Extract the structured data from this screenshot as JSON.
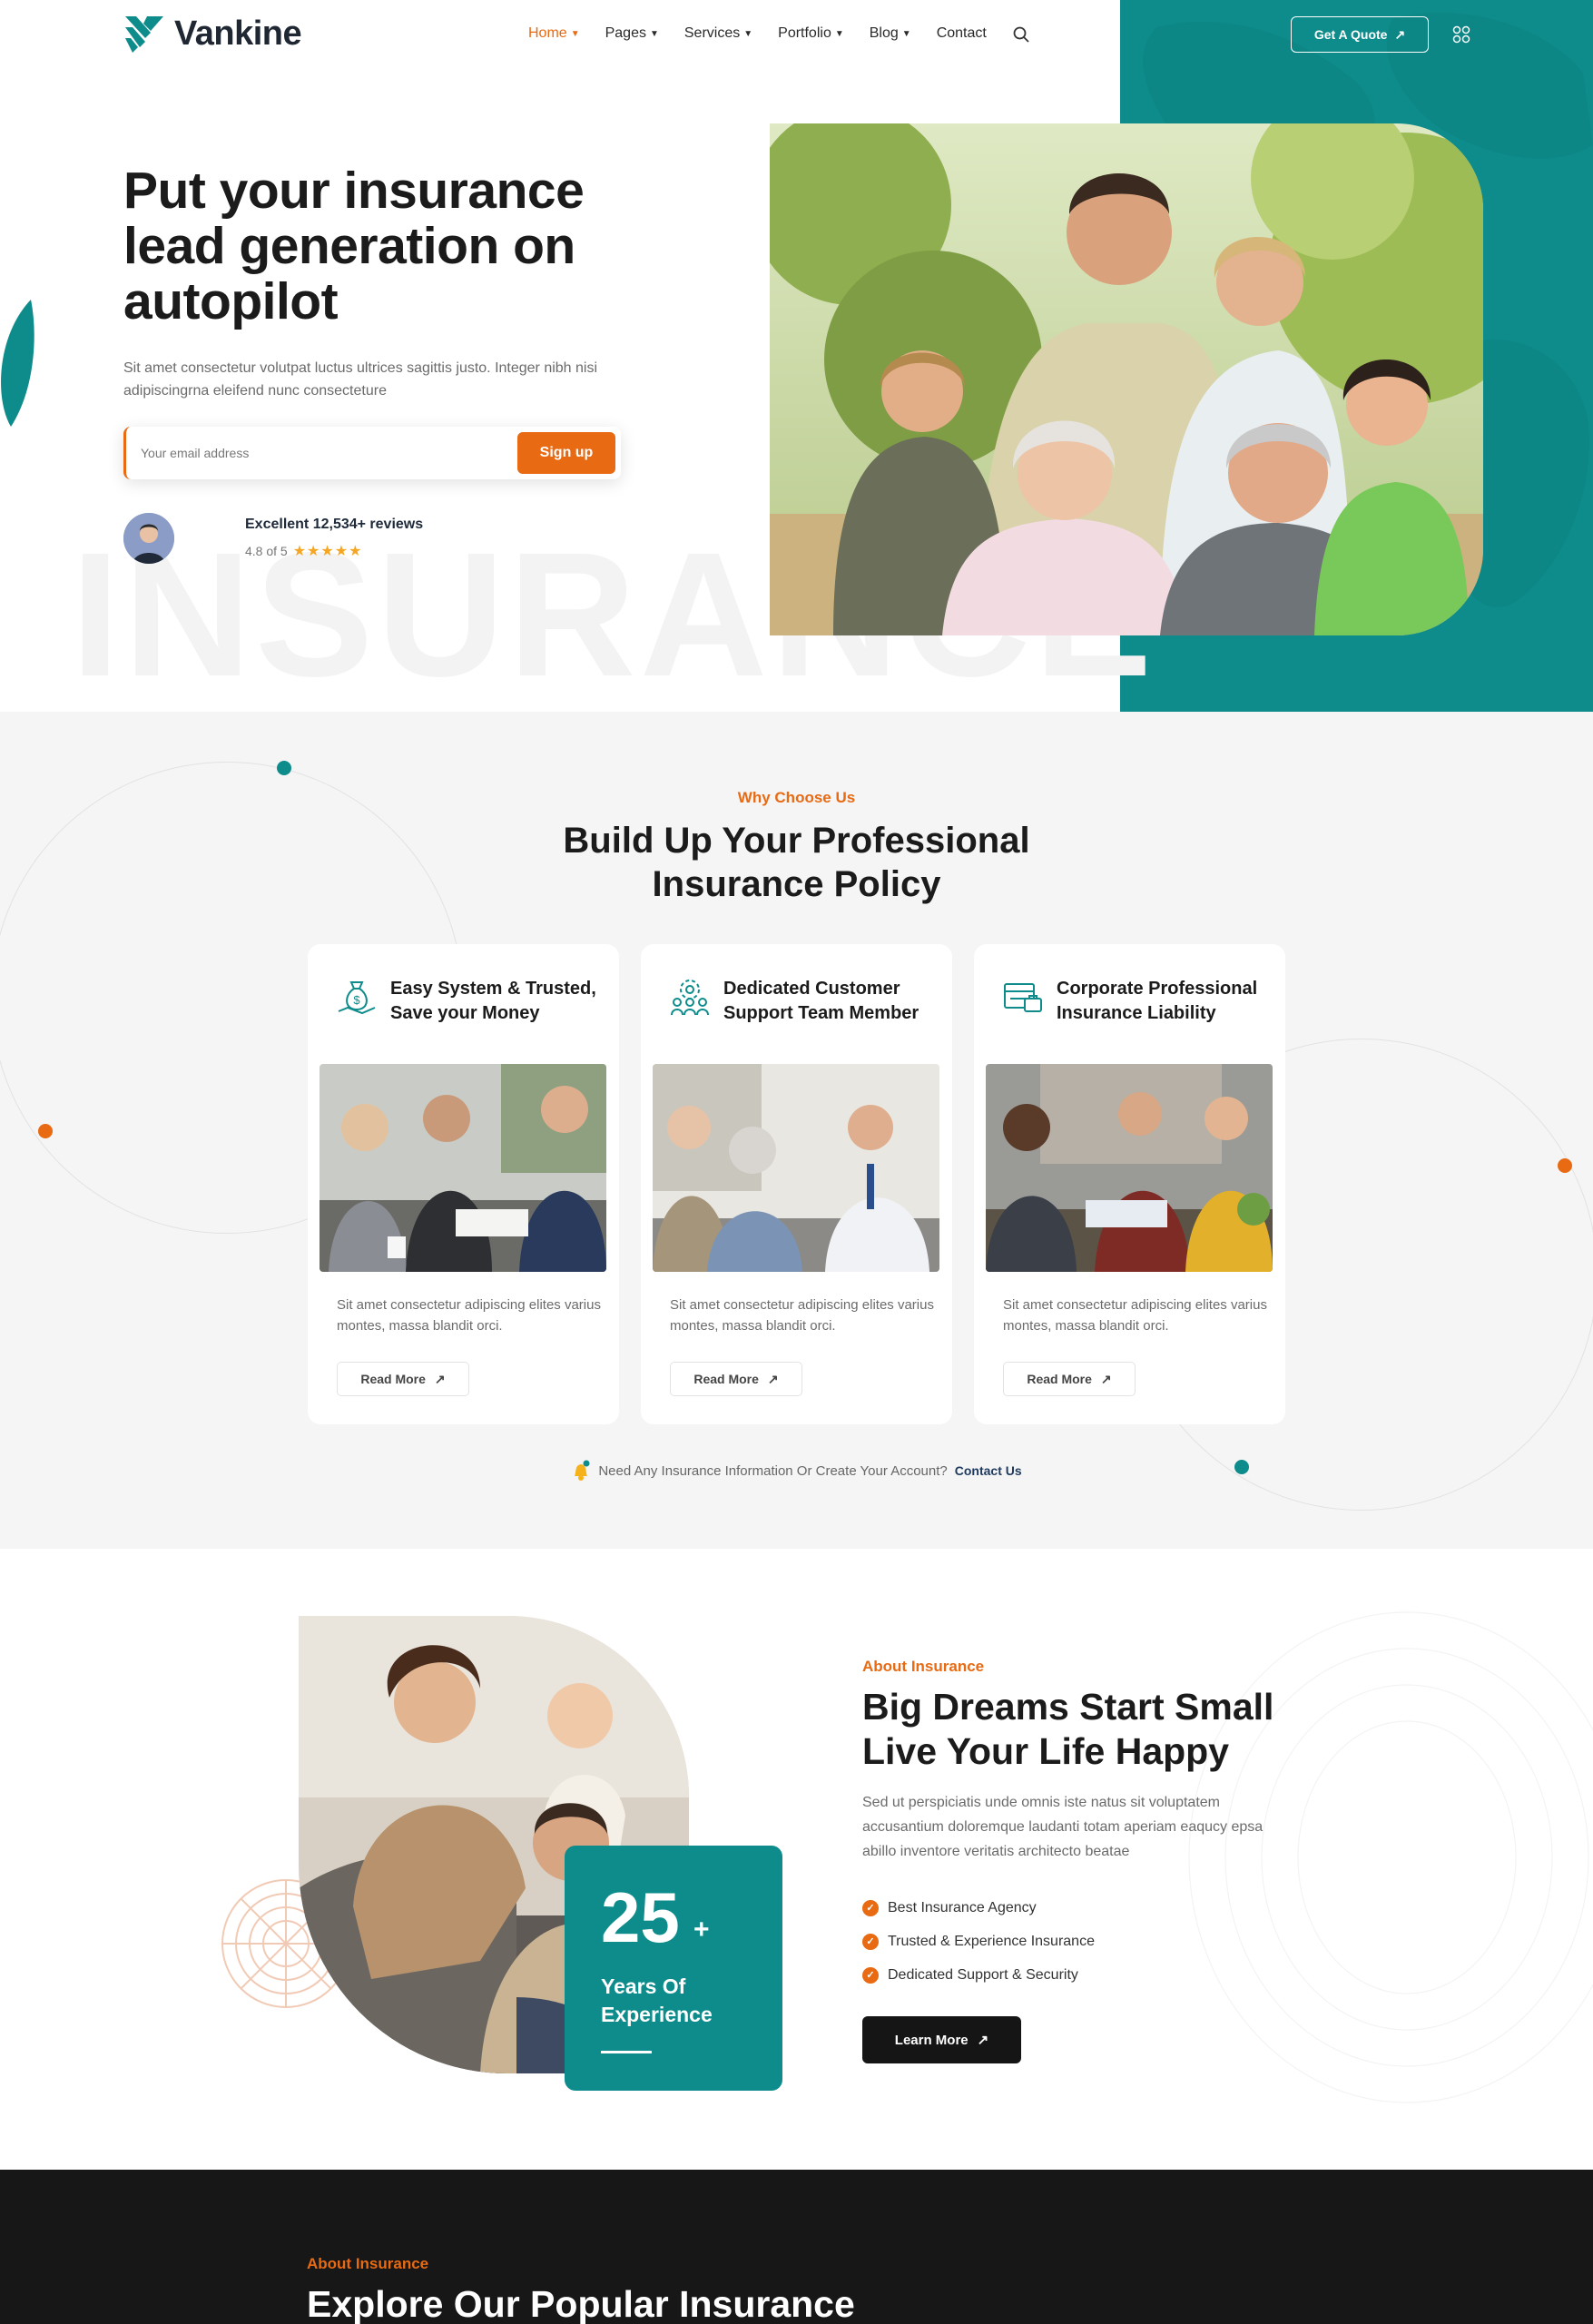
{
  "brand": {
    "name": "Vankine",
    "teal": "#0e8c8c",
    "orange": "#e86a12",
    "dark": "#171717"
  },
  "nav": {
    "items": [
      {
        "label": "Home",
        "active": true,
        "dropdown": true
      },
      {
        "label": "Pages",
        "dropdown": true
      },
      {
        "label": "Services",
        "dropdown": true
      },
      {
        "label": "Portfolio",
        "dropdown": true
      },
      {
        "label": "Blog",
        "dropdown": true
      },
      {
        "label": "Contact",
        "dropdown": false
      }
    ],
    "quote_label": "Get A Quote"
  },
  "hero": {
    "title": "Put your insurance lead generation on autopilot",
    "desc": "Sit amet consectetur volutpat luctus ultrices sagittis justo. Integer nibh nisi adipiscingrna eleifend nunc consecteture",
    "email_placeholder": "Your email address",
    "signup_label": "Sign up",
    "reviews_title": "Excellent 12,534+ reviews",
    "rating_text": "4.8 of 5",
    "rating_stars": 5,
    "watermark": "INSURANCE"
  },
  "why": {
    "eyebrow": "Why Choose Us",
    "title": "Build Up Your Professional Insurance Policy",
    "cards": [
      {
        "icon": "money-bag-icon",
        "title": "Easy System & Trusted, Save your Money",
        "text": "Sit amet consectetur adipiscing elites varius montes, massa blandit orci.",
        "button": "Read More"
      },
      {
        "icon": "support-team-icon",
        "title": "Dedicated Customer Support Team Member",
        "text": "Sit amet consectetur adipiscing elites varius montes, massa blandit orci.",
        "button": "Read More"
      },
      {
        "icon": "briefcase-document-icon",
        "title": "Corporate Professional Insurance Liability",
        "text": "Sit amet consectetur adipiscing elites varius montes, massa blandit orci.",
        "button": "Read More"
      }
    ],
    "contact_text": "Need Any Insurance Information Or Create Your Account?",
    "contact_link": "Contact Us"
  },
  "about": {
    "eyebrow": "About Insurance",
    "title": "Big Dreams Start Small Live Your Life Happy",
    "desc": "Sed ut perspiciatis unde omnis iste natus sit voluptatem accusantium doloremque laudanti totam aperiam eaqucy epsa abillo inventore veritatis architecto beatae",
    "checks": [
      "Best Insurance Agency",
      "Trusted & Experience Insurance",
      "Dedicated Support & Security"
    ],
    "years": "25",
    "years_plus": "+",
    "years_label": "Years Of Experience",
    "button": "Learn More"
  },
  "explore": {
    "eyebrow": "About Insurance",
    "title": "Explore Our Popular Insurance"
  }
}
